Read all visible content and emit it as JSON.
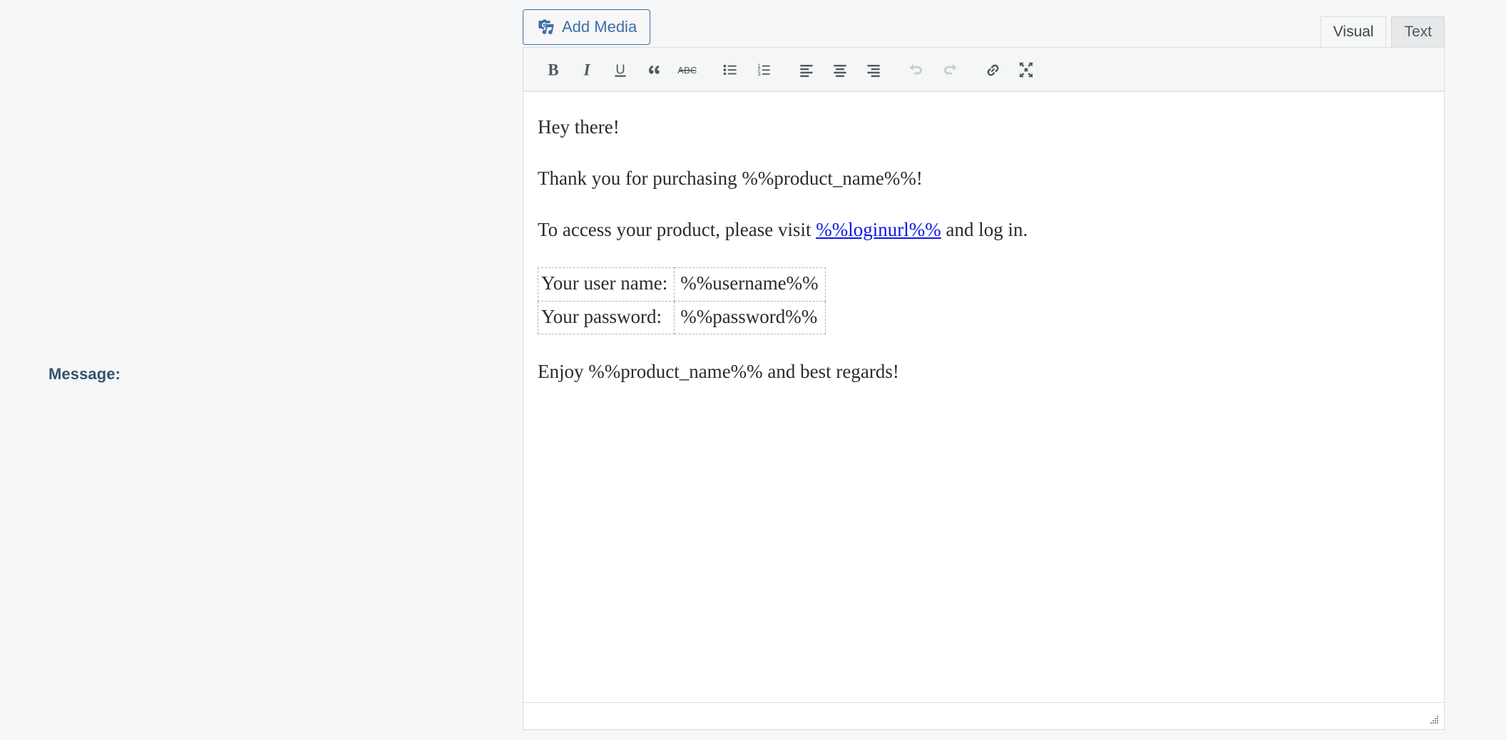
{
  "form": {
    "field_label": "Message:"
  },
  "editor": {
    "add_media_label": "Add Media",
    "add_media_icon": "media-camera-music-icon",
    "tabs": [
      {
        "label": "Visual",
        "active": true
      },
      {
        "label": "Text",
        "active": false
      }
    ],
    "toolbar": [
      {
        "name": "bold",
        "title": "Bold",
        "enabled": true
      },
      {
        "name": "italic",
        "title": "Italic",
        "enabled": true
      },
      {
        "name": "underline",
        "title": "Underline",
        "enabled": true
      },
      {
        "name": "blockquote",
        "title": "Blockquote",
        "enabled": true
      },
      {
        "name": "strikethrough",
        "title": "Strikethrough",
        "enabled": true
      },
      {
        "name": "bullist",
        "title": "Bulleted list",
        "enabled": true
      },
      {
        "name": "numlist",
        "title": "Numbered list",
        "enabled": true
      },
      {
        "name": "alignleft",
        "title": "Align left",
        "enabled": true
      },
      {
        "name": "aligncenter",
        "title": "Align center",
        "enabled": true
      },
      {
        "name": "alignright",
        "title": "Align right",
        "enabled": true
      },
      {
        "name": "undo",
        "title": "Undo",
        "enabled": false
      },
      {
        "name": "redo",
        "title": "Redo",
        "enabled": false
      },
      {
        "name": "link",
        "title": "Insert/edit link",
        "enabled": true
      },
      {
        "name": "fullscreen",
        "title": "Fullscreen",
        "enabled": true
      }
    ],
    "body": {
      "para_1": "Hey there!",
      "para_2": "Thank you for purchasing %%product_name%%!",
      "para_3_before": "To access your product, please visit ",
      "para_3_link": "%%loginurl%%",
      "para_3_after": " and log in.",
      "table": {
        "rows": [
          {
            "label": "Your user name:",
            "value": "%%username%%"
          },
          {
            "label": "Your password:",
            "value": "%%password%%"
          }
        ]
      },
      "para_4": "Enjoy %%product_name%% and best regards!"
    },
    "resize_grip_icon": "resize-grip-icon"
  },
  "colors": {
    "page_background": "#f6f7f8",
    "label_text": "#32556b",
    "accent_blue": "#3d6fa8",
    "link_blue": "#1015e8",
    "toolbar_background": "#f5f6f6",
    "icon": "#50575e",
    "icon_disabled": "#c7cbcf"
  }
}
